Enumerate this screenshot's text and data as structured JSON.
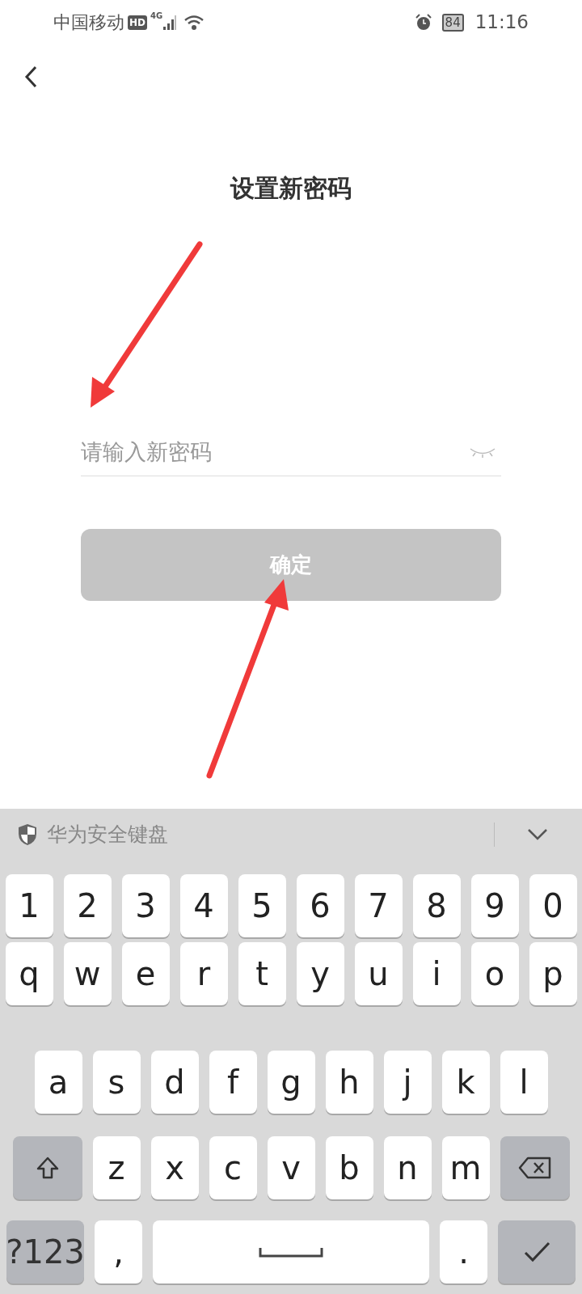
{
  "status_bar": {
    "carrier": "中国移动",
    "hd": "HD",
    "network": "4G",
    "battery": "84",
    "time": "11:16"
  },
  "title": "设置新密码",
  "password_field": {
    "placeholder": "请输入新密码"
  },
  "confirm_button": {
    "label": "确定",
    "disabled": true
  },
  "keyboard": {
    "name": "华为安全键盘",
    "rows": [
      [
        {
          "kind": "char",
          "label": "1"
        },
        {
          "kind": "char",
          "label": "2"
        },
        {
          "kind": "char",
          "label": "3"
        },
        {
          "kind": "char",
          "label": "4"
        },
        {
          "kind": "char",
          "label": "5"
        },
        {
          "kind": "char",
          "label": "6"
        },
        {
          "kind": "char",
          "label": "7"
        },
        {
          "kind": "char",
          "label": "8"
        },
        {
          "kind": "char",
          "label": "9"
        },
        {
          "kind": "char",
          "label": "0"
        }
      ],
      [
        {
          "kind": "char",
          "label": "q"
        },
        {
          "kind": "char",
          "label": "w"
        },
        {
          "kind": "char",
          "label": "e"
        },
        {
          "kind": "char",
          "label": "r"
        },
        {
          "kind": "char",
          "label": "t"
        },
        {
          "kind": "char",
          "label": "y"
        },
        {
          "kind": "char",
          "label": "u"
        },
        {
          "kind": "char",
          "label": "i"
        },
        {
          "kind": "char",
          "label": "o"
        },
        {
          "kind": "char",
          "label": "p"
        }
      ],
      [
        {
          "kind": "char",
          "label": "a"
        },
        {
          "kind": "char",
          "label": "s"
        },
        {
          "kind": "char",
          "label": "d"
        },
        {
          "kind": "char",
          "label": "f"
        },
        {
          "kind": "char",
          "label": "g"
        },
        {
          "kind": "char",
          "label": "h"
        },
        {
          "kind": "char",
          "label": "j"
        },
        {
          "kind": "char",
          "label": "k"
        },
        {
          "kind": "char",
          "label": "l"
        }
      ],
      [
        {
          "kind": "shift"
        },
        {
          "kind": "char",
          "label": "z"
        },
        {
          "kind": "char",
          "label": "x"
        },
        {
          "kind": "char",
          "label": "c"
        },
        {
          "kind": "char",
          "label": "v"
        },
        {
          "kind": "char",
          "label": "b"
        },
        {
          "kind": "char",
          "label": "n"
        },
        {
          "kind": "char",
          "label": "m"
        },
        {
          "kind": "backspace"
        }
      ],
      [
        {
          "kind": "symbols",
          "label": "?123"
        },
        {
          "kind": "char",
          "label": ","
        },
        {
          "kind": "space"
        },
        {
          "kind": "char",
          "label": "."
        },
        {
          "kind": "done"
        }
      ]
    ]
  }
}
